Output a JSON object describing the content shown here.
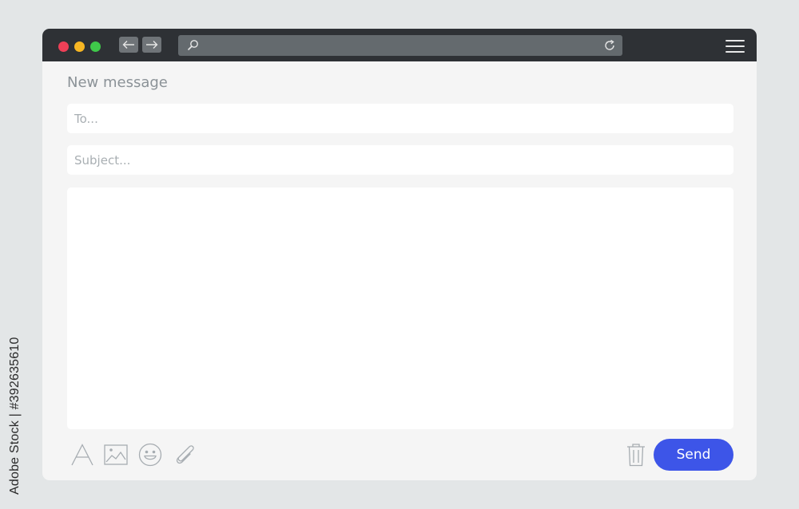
{
  "watermark": {
    "side_text": "Adobe Stock | #392635610"
  },
  "window": {
    "controls": [
      "close-dot",
      "minimize-dot",
      "maximize-dot"
    ],
    "nav": {
      "back_icon": "arrow-left-icon",
      "forward_icon": "arrow-right-icon"
    },
    "address_bar": {
      "value": "",
      "search_icon": "search-icon",
      "reload_icon": "reload-icon"
    },
    "menu_icon": "hamburger-menu-icon"
  },
  "compose": {
    "title": "New message",
    "to": {
      "value": "",
      "placeholder": "To..."
    },
    "subject": {
      "value": "",
      "placeholder": "Subject..."
    },
    "body": {
      "value": ""
    },
    "toolbar": {
      "icons": [
        "font-icon",
        "image-icon",
        "emoji-icon",
        "paperclip-icon",
        "trash-icon"
      ],
      "send_label": "Send"
    }
  },
  "colors": {
    "background": "#e3e6e7",
    "titlebar": "#2e3135",
    "window": "#f5f5f5",
    "send_button": "#3d55e8",
    "dot_red": "#ee4057",
    "dot_yellow": "#f7b623",
    "dot_green": "#3fc84a"
  }
}
